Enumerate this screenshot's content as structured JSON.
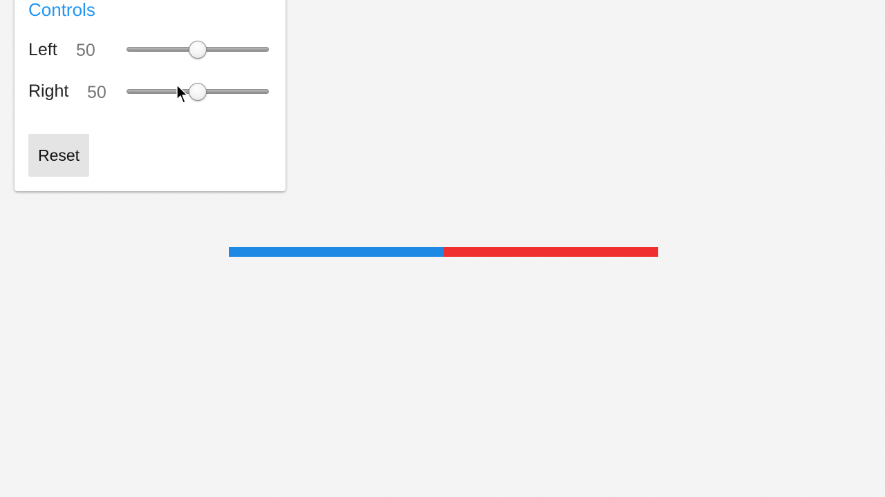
{
  "panel": {
    "title": "Controls",
    "sliders": [
      {
        "label": "Left",
        "value": "50",
        "level_percent": 50
      },
      {
        "label": "Right",
        "value": "50",
        "level_percent": 50
      }
    ],
    "reset_label": "Reset"
  },
  "bar": {
    "segments": [
      {
        "name": "left",
        "share_percent": 50,
        "color": "#1e88e5"
      },
      {
        "name": "right",
        "share_percent": 50,
        "color": "#f03030"
      }
    ]
  },
  "colors": {
    "accent": "#2196f3"
  },
  "icons": {
    "cursor": "arrow-pointer-icon"
  }
}
